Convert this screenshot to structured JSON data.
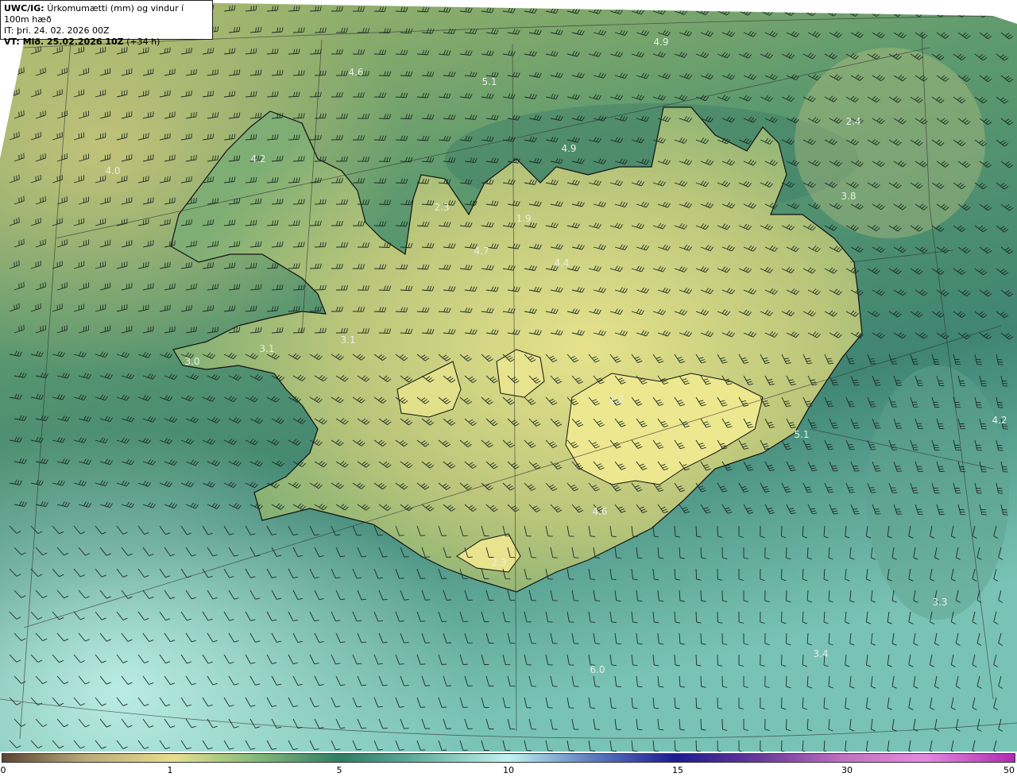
{
  "header": {
    "model_prefix": "UWC/IG:",
    "title": "Úrkomumætti (mm) og vindur í 100m hæð",
    "initial_time": "IT: þri. 24. 02. 2026 00Z",
    "valid_time": "VT: Mið. 25.02.2026 10Z",
    "lead_time": "(+34 h)"
  },
  "colorbar": {
    "ticks": [
      "0",
      "1",
      "5",
      "10",
      "15",
      "30",
      "50"
    ]
  },
  "map_values": [
    "4.9",
    "4.6",
    "5.1",
    "2.4",
    "4.2",
    "4.9",
    "4.0",
    "3.8",
    "2.3",
    "1.9",
    "4.7",
    "4.4",
    "3.1",
    "3.1",
    "3.0",
    "4.2",
    "5.1",
    "1.2",
    "4.6",
    "2.3",
    "3.3",
    "3.4",
    "6.0"
  ],
  "colors": {
    "land_light": "#e3e28c",
    "sea_dark": "#2e6f5e",
    "sea_light": "#9fe0d8",
    "coast": "#111111"
  },
  "icons": {
    "wind_barb": "wind-barb-icon"
  }
}
